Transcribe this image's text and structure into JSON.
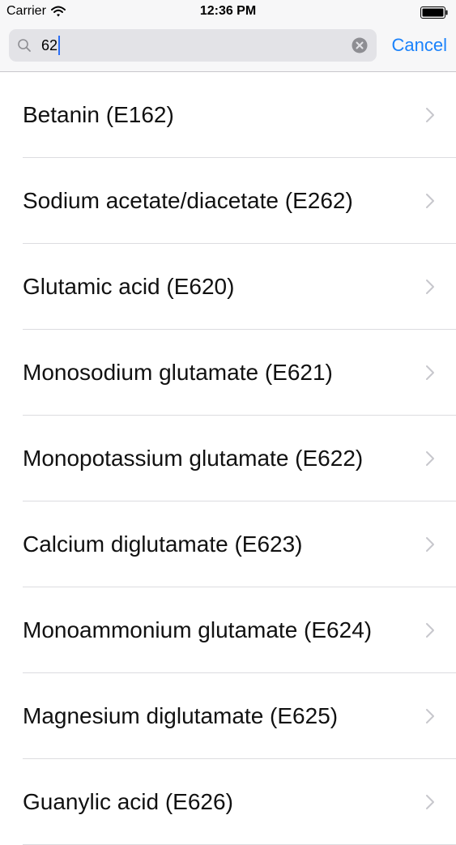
{
  "status_bar": {
    "carrier": "Carrier",
    "time": "12:36 PM"
  },
  "search": {
    "value": "62",
    "cancel_label": "Cancel"
  },
  "colors": {
    "accent": "#1a82fb",
    "caret": "#2b6ff5",
    "separator": "#dcdce0"
  },
  "results": [
    {
      "label": "Betanin (E162)"
    },
    {
      "label": "Sodium acetate/diacetate (E262)"
    },
    {
      "label": "Glutamic acid (E620)"
    },
    {
      "label": "Monosodium glutamate (E621)"
    },
    {
      "label": "Monopotassium glutamate (E622)"
    },
    {
      "label": "Calcium diglutamate (E623)"
    },
    {
      "label": "Monoammonium glutamate (E624)"
    },
    {
      "label": "Magnesium diglutamate (E625)"
    },
    {
      "label": "Guanylic acid (E626)"
    }
  ]
}
